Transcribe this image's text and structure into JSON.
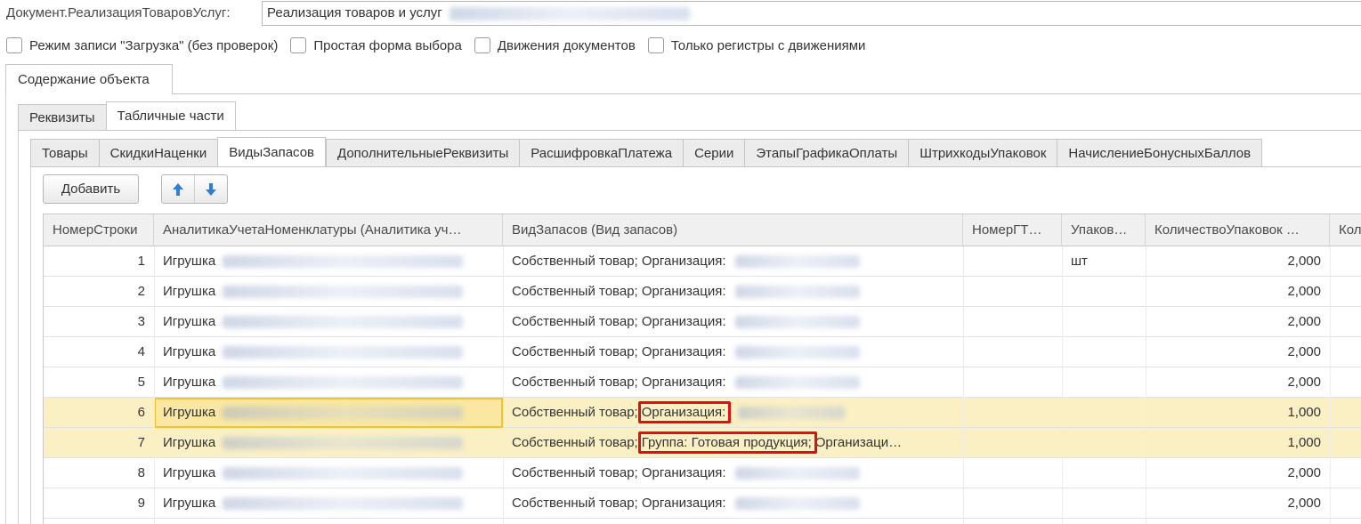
{
  "header": {
    "doc_label": "Документ.РеализацияТоваровУслуг:",
    "doc_value": "Реализация товаров и услуг"
  },
  "options": [
    {
      "label": "Режим записи \"Загрузка\" (без проверок)",
      "checked": false
    },
    {
      "label": "Простая форма выбора",
      "checked": false
    },
    {
      "label": "Движения документов",
      "checked": false
    },
    {
      "label": "Только регистры с движениями",
      "checked": false
    }
  ],
  "outer_tab": "Содержание объекта",
  "inner_tabs": [
    "Реквизиты",
    "Табличные части"
  ],
  "sub_tabs": [
    "Товары",
    "СкидкиНаценки",
    "ВидыЗапасов",
    "ДополнительныеРеквизиты",
    "РасшифровкаПлатежа",
    "Серии",
    "ЭтапыГрафикаОплаты",
    "ШтрихкодыУпаковок",
    "НачислениеБонусныхБаллов"
  ],
  "toolbar": {
    "add_label": "Добавить",
    "up_icon": "arrow-up-icon",
    "down_icon": "arrow-down-icon"
  },
  "table": {
    "columns": [
      "НомерСтроки",
      "АналитикаУчетаНоменклатуры (Аналитика уч…",
      "ВидЗапасов (Вид запасов)",
      "НомерГТ…",
      "Упаков…",
      "КоличествоУпаковок …",
      "Кол"
    ],
    "rows": [
      {
        "n": "1",
        "analytics": "Игрушка",
        "kind": "Собственный товар; Организация:",
        "gtd": "",
        "pack": "шт",
        "qty": "2,000"
      },
      {
        "n": "2",
        "analytics": "Игрушка",
        "kind": "Собственный товар; Организация:",
        "gtd": "",
        "pack": "",
        "qty": "2,000"
      },
      {
        "n": "3",
        "analytics": "Игрушка",
        "kind": "Собственный товар; Организация:",
        "gtd": "",
        "pack": "",
        "qty": "2,000"
      },
      {
        "n": "4",
        "analytics": "Игрушка",
        "kind": "Собственный товар; Организация:",
        "gtd": "",
        "pack": "",
        "qty": "2,000"
      },
      {
        "n": "5",
        "analytics": "Игрушка",
        "kind": "Собственный товар; Организация:",
        "gtd": "",
        "pack": "",
        "qty": "2,000"
      },
      {
        "n": "6",
        "analytics": "Игрушка",
        "kind_pre": "Собственный товар;",
        "kind_hl": "Организация:",
        "kind_post": "",
        "gtd": "",
        "pack": "",
        "qty": "1,000"
      },
      {
        "n": "7",
        "analytics": "Игрушка",
        "kind_pre": "Собственный товар;",
        "kind_hl": "Группа: Готовая продукция;",
        "kind_post": "Организаци…",
        "gtd": "",
        "pack": "",
        "qty": "1,000"
      },
      {
        "n": "8",
        "analytics": "Игрушка",
        "kind": "Собственный товар; Организация:",
        "gtd": "",
        "pack": "",
        "qty": "2,000"
      },
      {
        "n": "9",
        "analytics": "Игрушка",
        "kind": "Собственный товар; Организация:",
        "gtd": "",
        "pack": "",
        "qty": "2,000"
      }
    ]
  },
  "colors": {
    "selected_row": "#fbf0c4",
    "focus_border": "#f1c232",
    "highlight_box": "#e01010",
    "arrow_blue": "#2f7fd6"
  }
}
